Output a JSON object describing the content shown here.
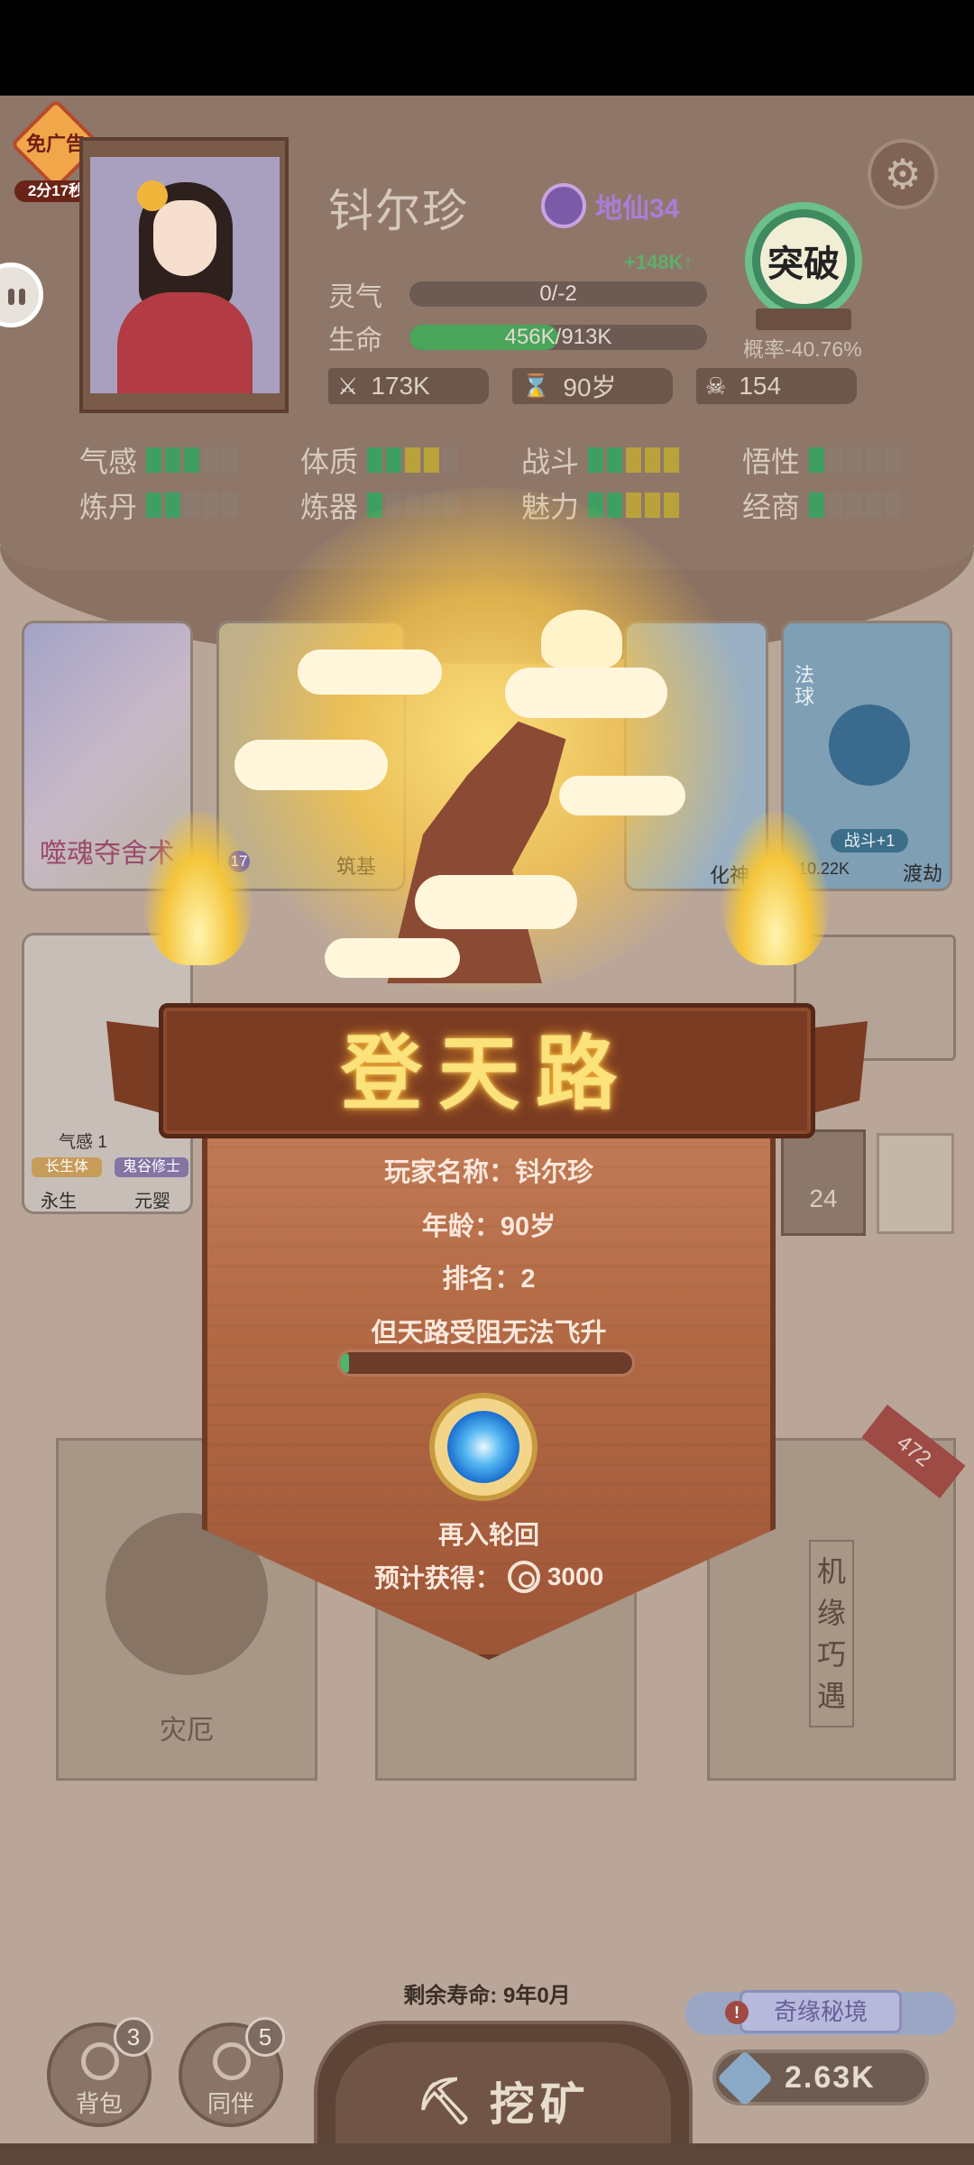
{
  "header": {
    "ad_badge": {
      "label": "免广告",
      "timer": "2分17秒"
    },
    "character_name": "钭尔珍",
    "realm": "地仙34",
    "qi_gain": "+148K↑",
    "stats": [
      {
        "label": "灵气",
        "value": "0/-2",
        "progress": 0.0
      },
      {
        "label": "生命",
        "value": "456K/913K",
        "progress": 0.5
      }
    ],
    "chips": {
      "attack": "173K",
      "age": "90岁",
      "kills": "154"
    },
    "breakthrough": {
      "label": "突破",
      "probability": "概率-40.76%"
    },
    "attributes": [
      {
        "label": "气感",
        "filled": 3,
        "color": "green"
      },
      {
        "label": "体质",
        "filled": 4,
        "color": "mixed"
      },
      {
        "label": "战斗",
        "filled": 5,
        "color": "mixed"
      },
      {
        "label": "悟性",
        "filled": 1,
        "color": "green"
      },
      {
        "label": "炼丹",
        "filled": 2,
        "color": "green"
      },
      {
        "label": "炼器",
        "filled": 1,
        "color": "green"
      },
      {
        "label": "魅力",
        "filled": 5,
        "color": "mixed"
      },
      {
        "label": "经商",
        "filled": 1,
        "color": "green"
      }
    ]
  },
  "cards": {
    "card1_title": "噬魂夺舍术",
    "card2": {
      "num1": "17",
      "bottom": "筑基"
    },
    "card3_bottom": "化神",
    "card4": {
      "tag": "法球",
      "pill": "战斗+1",
      "value": "10.22K",
      "bottom": "渡劫"
    },
    "card5": {
      "attr": "气感 1",
      "tag1": "长生体",
      "tag2": "鬼谷修士",
      "bottom_left": "永生",
      "bottom_right": "元婴"
    }
  },
  "side_slots": {
    "count": "24"
  },
  "packs": {
    "left_label": "灾厄",
    "right_scroll": "机缘巧遇",
    "ribbon": "472"
  },
  "modal": {
    "title": "登天路",
    "player_line": "玩家名称：钭尔珍",
    "age_line": "年龄：90岁",
    "rank_line": "排名：2",
    "status_line": "但天路受阻无法飞升",
    "progress": 0.03,
    "action_label": "再入轮回",
    "reward_prefix": "预计获得：",
    "reward_value": "3000"
  },
  "footer": {
    "lifespan": "剩余寿命: 9年0月",
    "bag": {
      "label": "背包",
      "badge": "3"
    },
    "partner": {
      "label": "同伴",
      "badge": "5"
    },
    "mine": "挖矿",
    "secret_realm": "奇缘秘境",
    "gems": "2.63K"
  },
  "colors": {
    "accent_green": "#48a55a",
    "title_gold": "#fbe27a",
    "modal_brown": "#b26a45"
  }
}
